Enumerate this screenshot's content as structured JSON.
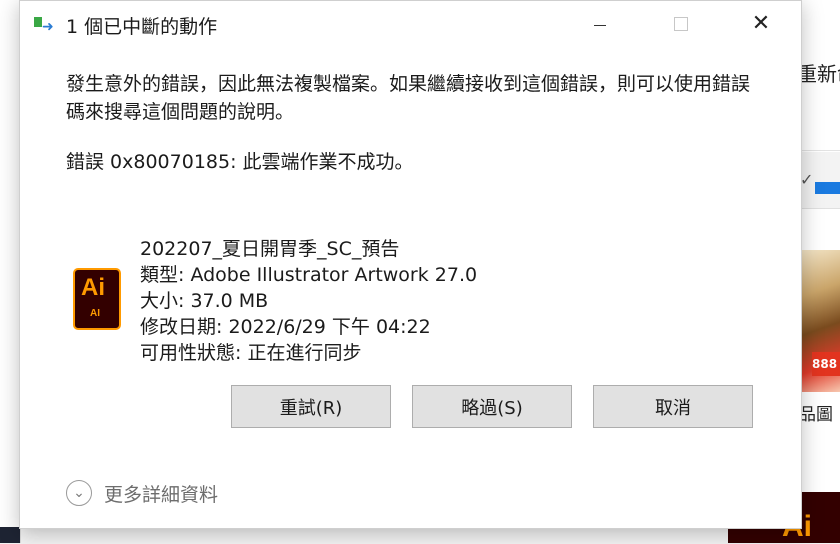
{
  "dialog": {
    "title": "1 個已中斷的動作",
    "message": "發生意外的錯誤，因此無法複製檔案。如果繼續接收到這個錯誤，則可以使用錯誤碼來搜尋這個問題的說明。",
    "error_line": "錯誤 0x80070185: 此雲端作業不成功。",
    "file": {
      "icon_text": "Ai",
      "icon_subtext": "AI",
      "name": "202207_夏日開胃季_SC_預告",
      "type": "類型: Adobe Illustrator Artwork 27.0",
      "size": "大小: 37.0 MB",
      "modified": "修改日期: 2022/6/29 下午 04:22",
      "availability": "可用性狀態: 正在進行同步"
    },
    "buttons": {
      "retry": "重試(R)",
      "skip": "略過(S)",
      "cancel": "取消"
    },
    "more_details": "更多詳細資料"
  },
  "background": {
    "right_text_top": "重新命",
    "right_text_mid": "品圖",
    "thumb_badge": "888",
    "ai_thumb_text": "Ai"
  },
  "colors": {
    "ai_dark": "#330000",
    "ai_orange": "#ff9a00",
    "button_bg": "#e1e1e1",
    "accent_blue": "#1a7ae0"
  }
}
